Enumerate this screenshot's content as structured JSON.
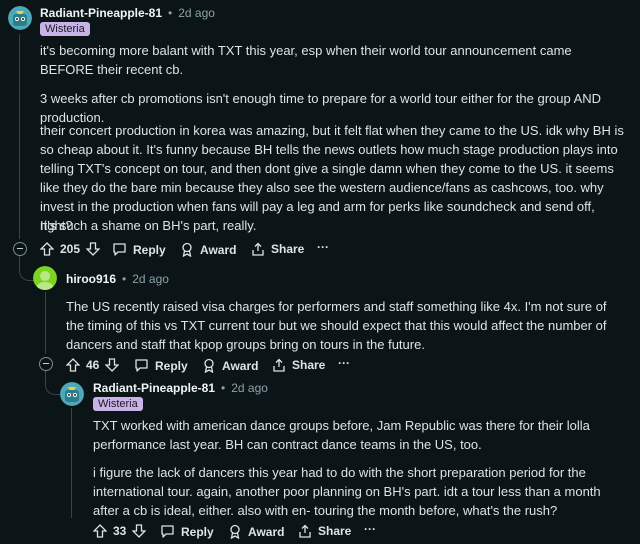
{
  "comments": [
    {
      "username": "Radiant-Pineapple-81",
      "separator": "•",
      "time": "2d ago",
      "flair": "Wisteria",
      "paragraphs": [
        "it's becoming more balant with TXT this year, esp when their world tour announcement came BEFORE their recent cb.",
        "3 weeks after cb promotions isn't enough time to prepare for a world tour either for the group AND production.",
        "their concert production in korea was amazing, but it felt flat when they came to the US. idk why BH is so cheap about it. It's funny because BH tells the news outlets how much stage production plays into telling TXT's concept on tour, and then dont give a single damn when they come to the US. it seems like they do the bare min because they also see the western audience/fans as cashcows, too. why invest in the production when fans will pay a leg and arm for perks like soundcheck and send off, right?",
        "It's such a shame on BH's part, really."
      ],
      "votes": "205",
      "reply": "Reply",
      "award": "Award",
      "share": "Share",
      "more": "···"
    },
    {
      "username": "hiroo916",
      "separator": "•",
      "time": "2d ago",
      "paragraphs": [
        "The US recently raised visa charges for performers and staff something like 4x. I'm not sure of the timing of this vs TXT current tour but we should expect that this would affect the number of dancers and staff that kpop groups bring on tours in the future."
      ],
      "votes": "46",
      "reply": "Reply",
      "award": "Award",
      "share": "Share",
      "more": "···"
    },
    {
      "username": "Radiant-Pineapple-81",
      "separator": "•",
      "time": "2d ago",
      "flair": "Wisteria",
      "paragraphs": [
        "TXT worked with american dance groups before, Jam Republic was there for their lolla performance last year. BH can contract dance teams in the US, too.",
        "i figure the lack of dancers this year had to do with the short preparation period for the international tour. again, another poor planning on BH's part. idt a tour less than a month after a cb is ideal, either. also with en- touring the month before, what's the rush?"
      ],
      "votes": "33",
      "reply": "Reply",
      "award": "Award",
      "share": "Share",
      "more": "···"
    }
  ]
}
